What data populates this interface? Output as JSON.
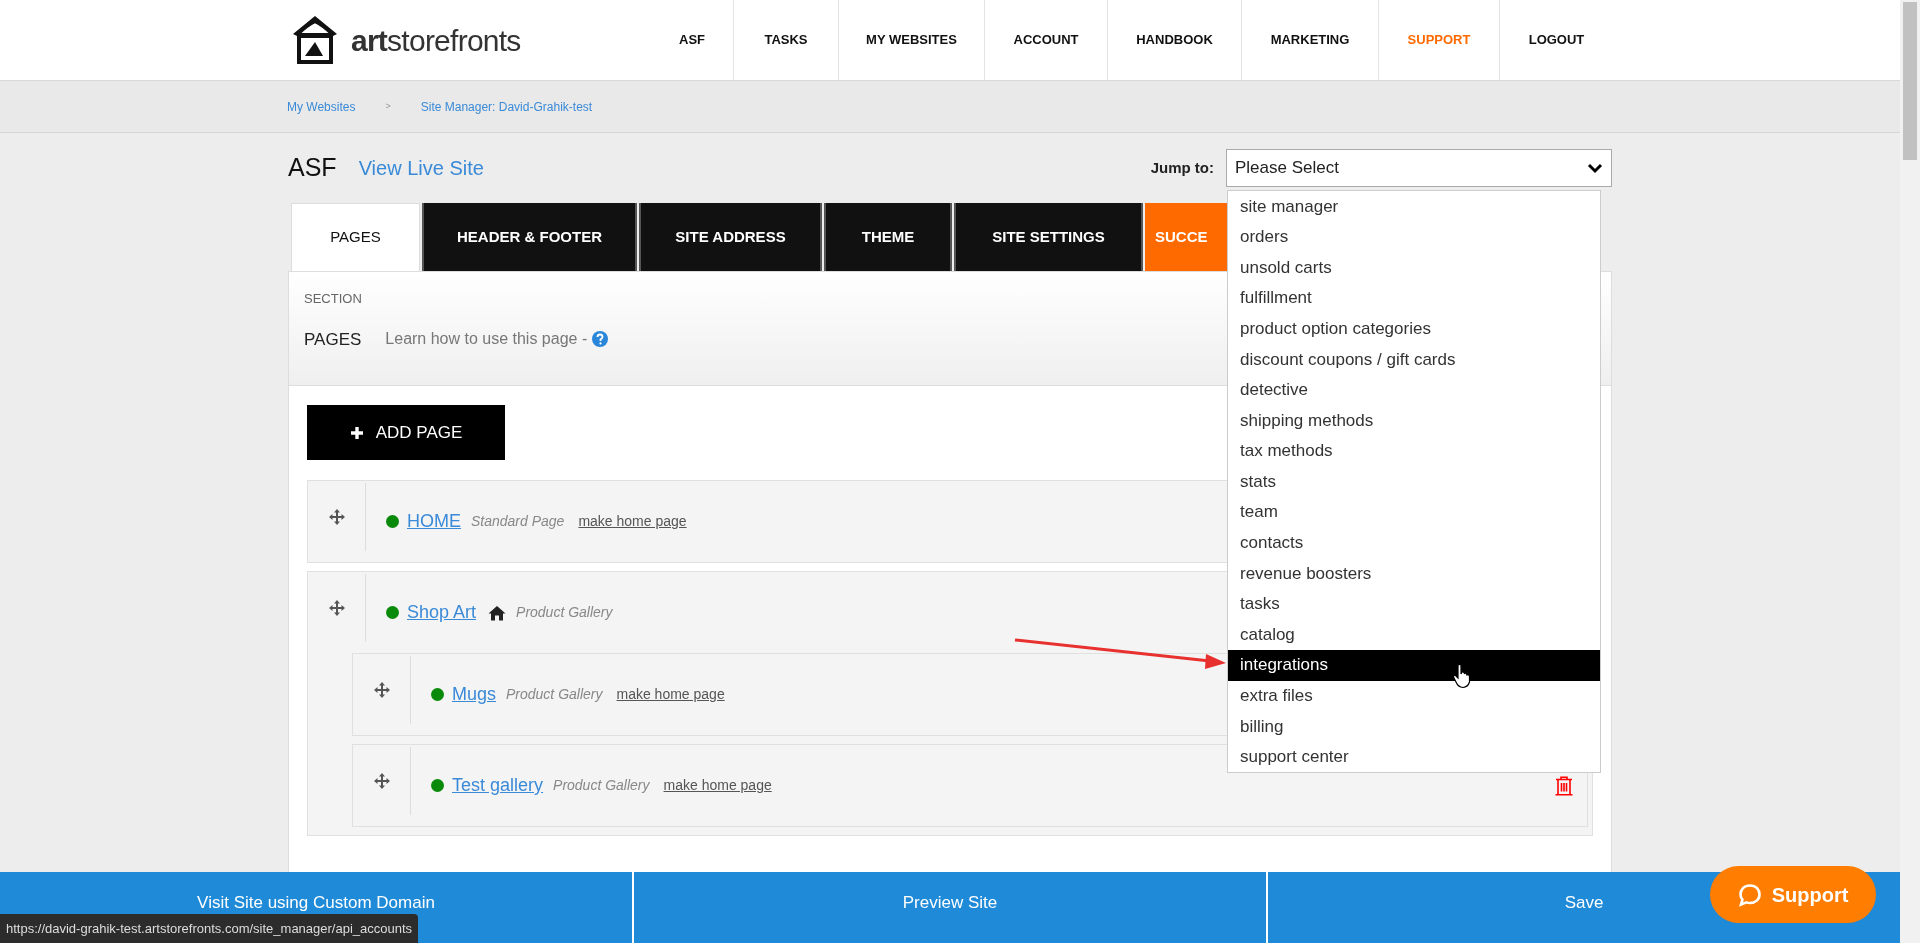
{
  "header": {
    "logo": "**art**storefronts",
    "nav": [
      {
        "label": "ASF",
        "selected": false
      },
      {
        "label": "TASKS",
        "selected": false
      },
      {
        "label": "MY WEBSITES",
        "selected": false
      },
      {
        "label": "ACCOUNT",
        "selected": false
      },
      {
        "label": "HANDBOOK",
        "selected": false
      },
      {
        "label": "MARKETING",
        "selected": false
      },
      {
        "label": "SUPPORT",
        "selected": true
      },
      {
        "label": "LOGOUT",
        "selected": false
      }
    ]
  },
  "breadcrumbs": {
    "items": [
      "My Websites",
      "Site Manager: David-Grahik-test"
    ],
    "separator": ">"
  },
  "title": "ASF",
  "view_live_link": "View Live Site",
  "jump_to": {
    "label": "Jump to:",
    "value": "Please Select",
    "expanded": true,
    "options": [
      {
        "label": "site manager",
        "selected": false
      },
      {
        "label": "orders",
        "selected": false
      },
      {
        "label": "unsold carts",
        "selected": false
      },
      {
        "label": "fulfillment",
        "selected": false
      },
      {
        "label": "product option categories",
        "selected": false
      },
      {
        "label": "discount coupons / gift cards",
        "selected": false
      },
      {
        "label": "detective",
        "selected": false
      },
      {
        "label": "shipping methods",
        "selected": false
      },
      {
        "label": "tax methods",
        "selected": false
      },
      {
        "label": "stats",
        "selected": false
      },
      {
        "label": "team",
        "selected": false
      },
      {
        "label": "contacts",
        "selected": false
      },
      {
        "label": "revenue boosters",
        "selected": false
      },
      {
        "label": "tasks",
        "selected": false
      },
      {
        "label": "catalog",
        "selected": false
      },
      {
        "label": "integrations",
        "selected": true
      },
      {
        "label": "extra files",
        "selected": false
      },
      {
        "label": "billing",
        "selected": false
      },
      {
        "label": "support center",
        "selected": false
      }
    ]
  },
  "tabs": [
    {
      "label": "PAGES",
      "selected": true,
      "kind": "plain"
    },
    {
      "label": "HEADER & FOOTER",
      "selected": false,
      "kind": "plain"
    },
    {
      "label": "SITE ADDRESS",
      "selected": false,
      "kind": "plain"
    },
    {
      "label": "THEME",
      "selected": false,
      "kind": "plain"
    },
    {
      "label": "SITE SETTINGS",
      "selected": false,
      "kind": "plain"
    },
    {
      "label": "SUCCE",
      "selected": false,
      "kind": "accent"
    }
  ],
  "section": {
    "label": "SECTION",
    "title": "PAGES",
    "help": "Learn how to use this page -"
  },
  "add_page_button": "ADD PAGE",
  "pages": [
    {
      "name": "HOME",
      "type": "Standard Page",
      "is_home": false,
      "action": "make home page"
    },
    {
      "name": "Shop Art",
      "type": "Product Gallery",
      "is_home": true,
      "children": [
        {
          "name": "Mugs",
          "type": "Product Gallery",
          "is_home": false,
          "action": "make home page"
        },
        {
          "name": "Test gallery",
          "type": "Product Gallery",
          "is_home": false,
          "action": "make home page",
          "delete": true
        }
      ]
    }
  ],
  "bottom_bar": [
    "Visit Site using Custom Domain",
    "Preview Site",
    "Save"
  ],
  "support_button": "Support",
  "status_url": "https://david-grahik-test.artstorefronts.com/site_manager/api_accounts"
}
